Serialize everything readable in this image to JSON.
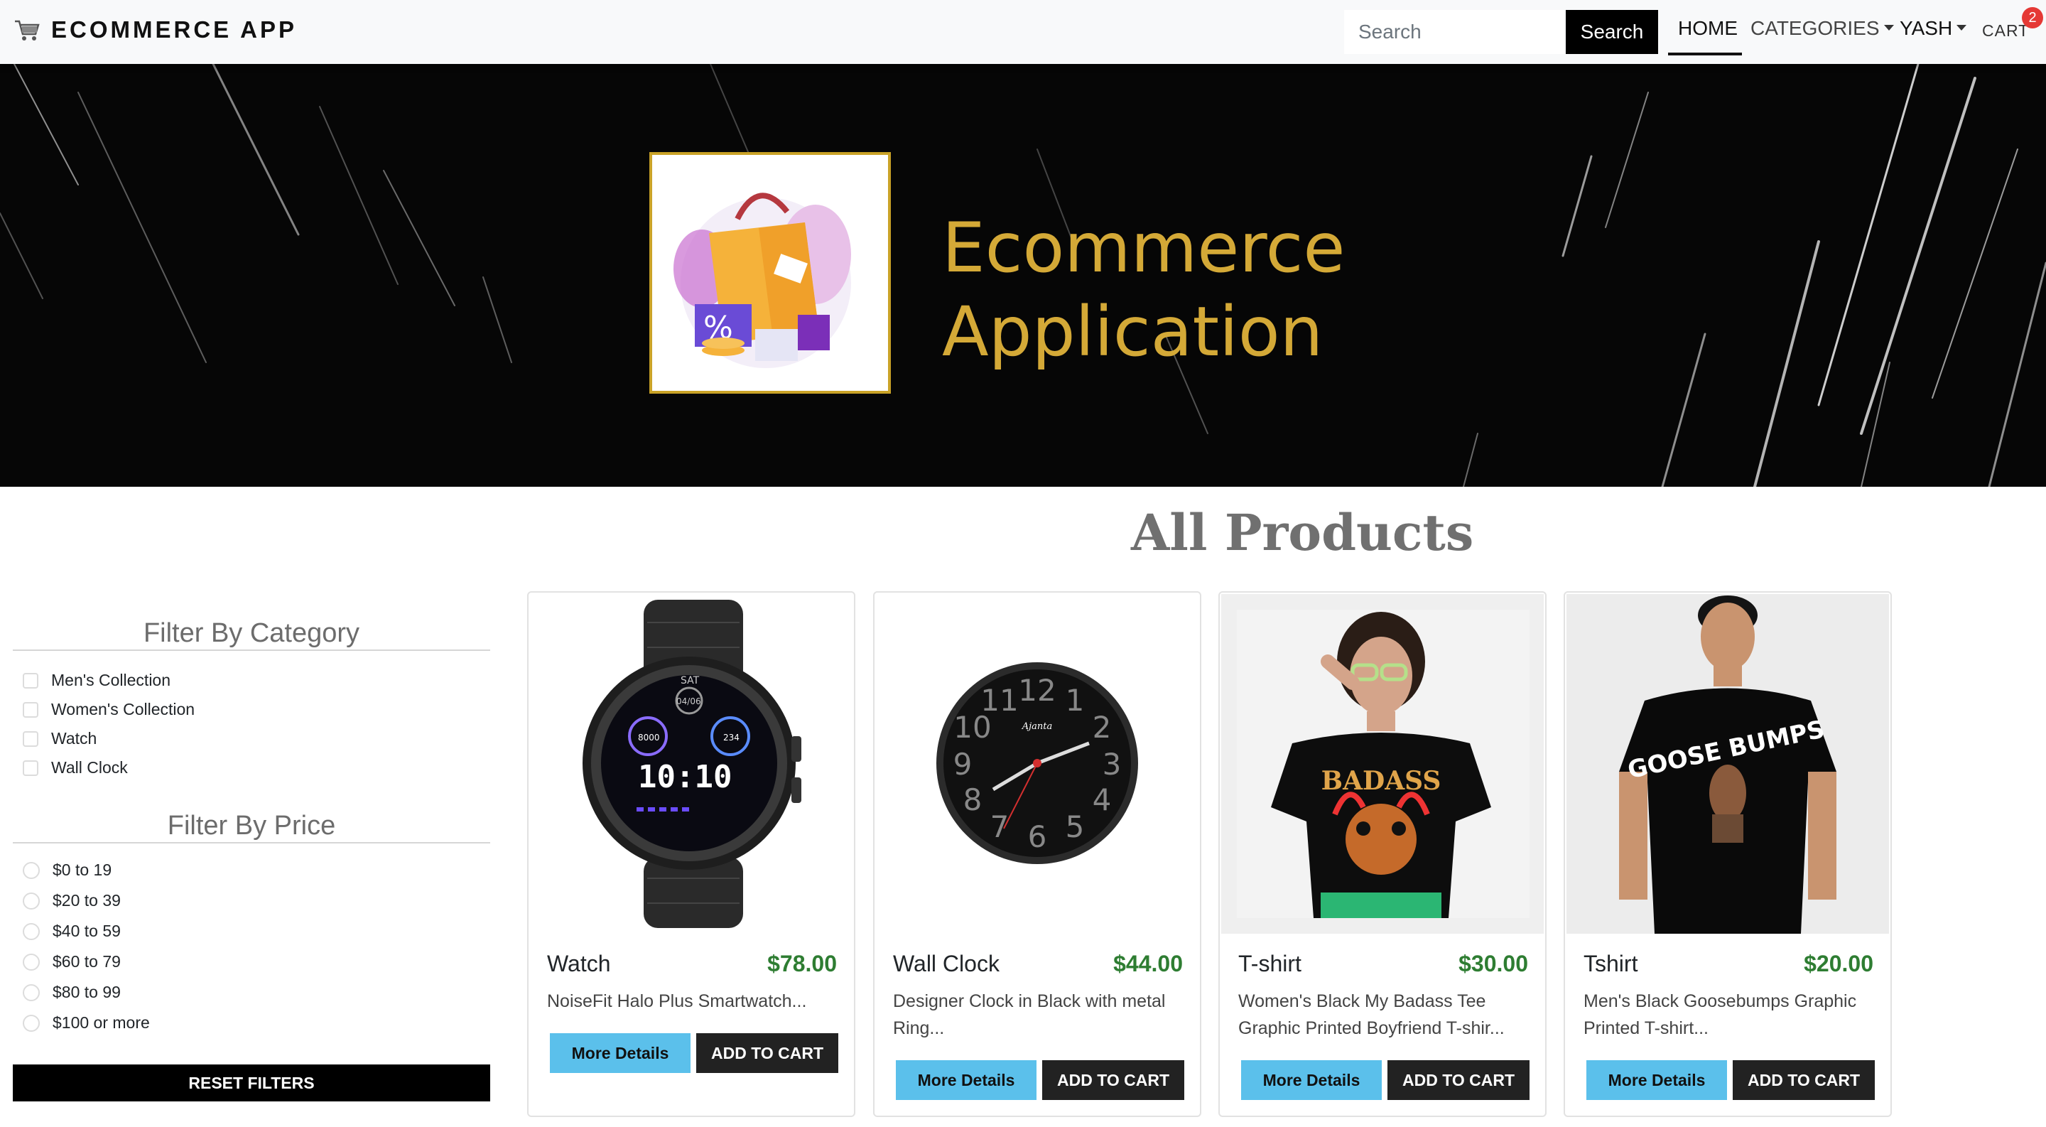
{
  "navbar": {
    "brand": "ECOMMERCE APP",
    "brand_icon": "shopping-cart-icon",
    "search_placeholder": "Search",
    "search_button": "Search",
    "links": {
      "home": "HOME",
      "categories": "CATEGORIES",
      "user": "YASH",
      "cart": "CART"
    },
    "cart_count": "2"
  },
  "banner": {
    "line1": "Ecommerce",
    "line2": "Application"
  },
  "main": {
    "heading": "All Products"
  },
  "sidebar": {
    "category_title": "Filter By Category",
    "categories": [
      "Men's Collection",
      "Women's Collection",
      "Watch",
      "Wall Clock"
    ],
    "price_title": "Filter By Price",
    "prices": [
      "$0 to 19",
      "$20 to 39",
      "$40 to 59",
      "$60 to 79",
      "$80 to 99",
      "$100 or more"
    ],
    "reset_label": "RESET FILTERS"
  },
  "products": [
    {
      "name": "Watch",
      "price": "$78.00",
      "description": "NoiseFit Halo Plus Smartwatch...",
      "more_label": "More Details",
      "add_label": "ADD TO CART"
    },
    {
      "name": "Wall Clock",
      "price": "$44.00",
      "description": "Designer Clock in Black with metal Ring...",
      "more_label": "More Details",
      "add_label": "ADD TO CART"
    },
    {
      "name": "T-shirt",
      "price": "$30.00",
      "description": "Women's Black My Badass Tee Graphic Printed Boyfriend T-shir...",
      "more_label": "More Details",
      "add_label": "ADD TO CART"
    },
    {
      "name": "Tshirt",
      "price": "$20.00",
      "description": "Men's Black Goosebumps Graphic Printed T-shirt...",
      "more_label": "More Details",
      "add_label": "ADD TO CART"
    }
  ],
  "product_images": {
    "watch_screen": {
      "day": "SAT",
      "date": "04/06",
      "time": "10:10",
      "steps": "8000",
      "hr": "234"
    },
    "clock_numbers": [
      "12",
      "1",
      "2",
      "3",
      "4",
      "5",
      "6",
      "7",
      "8",
      "9",
      "10",
      "11"
    ],
    "clock_brand": "Ajanta",
    "tee_women_print": "BADASS",
    "tee_men_print": "GOOSE BUMPS"
  },
  "colors": {
    "price": "#2e7d32",
    "more_button": "#5bc0eb",
    "add_button": "#222222",
    "banner_gold": "#d4a937",
    "badge": "#e53935"
  }
}
